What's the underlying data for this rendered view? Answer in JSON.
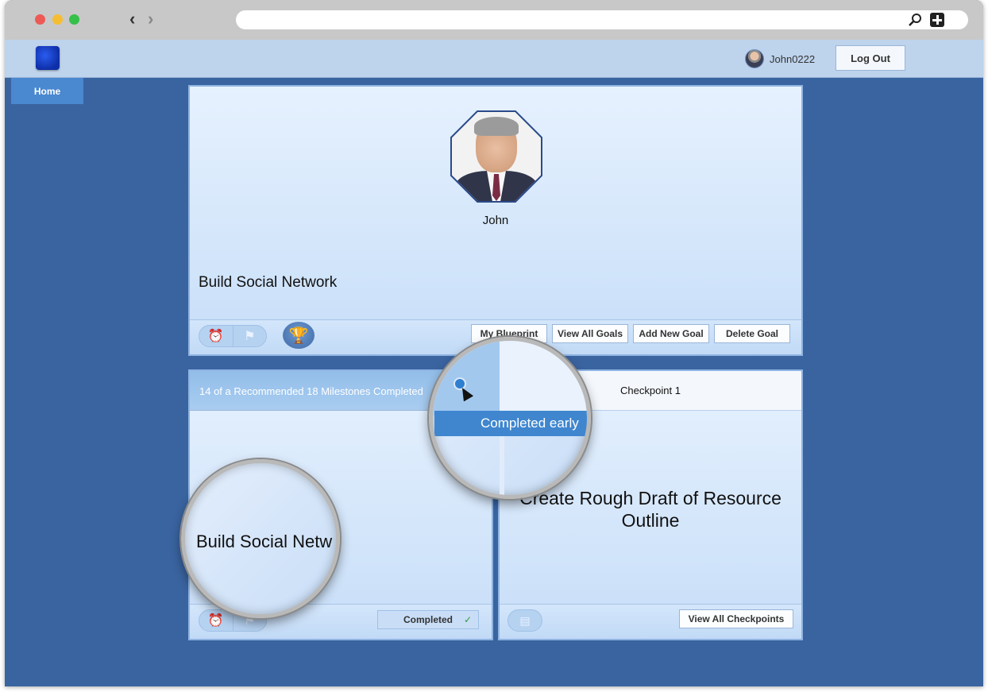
{
  "header": {
    "username": "John0222",
    "logout_label": "Log Out"
  },
  "nav": {
    "home_label": "Home"
  },
  "profile": {
    "name": "John"
  },
  "goal": {
    "title": "Build Social Network",
    "buttons": {
      "blueprint": "My Blueprint",
      "view_all_goals": "View All Goals",
      "add_new_goal": "Add New Goal",
      "delete_goal": "Delete Goal"
    }
  },
  "milestone": {
    "summary": "14 of a Recommended 18 Milestones Completed",
    "status_button": "Completed",
    "check_glyph": "✓",
    "tooltip": "Completed early",
    "magnified_title": "Build Social Netw"
  },
  "checkpoint": {
    "header": "Checkpoint 1",
    "title": "Create Rough Draft of Resource Outline",
    "view_all_label": "View All Checkpoints"
  },
  "icons": {
    "alarm": "⏰",
    "flag": "⚑",
    "trophy": "🏆",
    "document": "▤"
  },
  "colors": {
    "page_background": "#3a64a0",
    "header_background": "#bed3ec",
    "home_tab": "#4a88d0",
    "tooltip": "#3f86cf"
  }
}
